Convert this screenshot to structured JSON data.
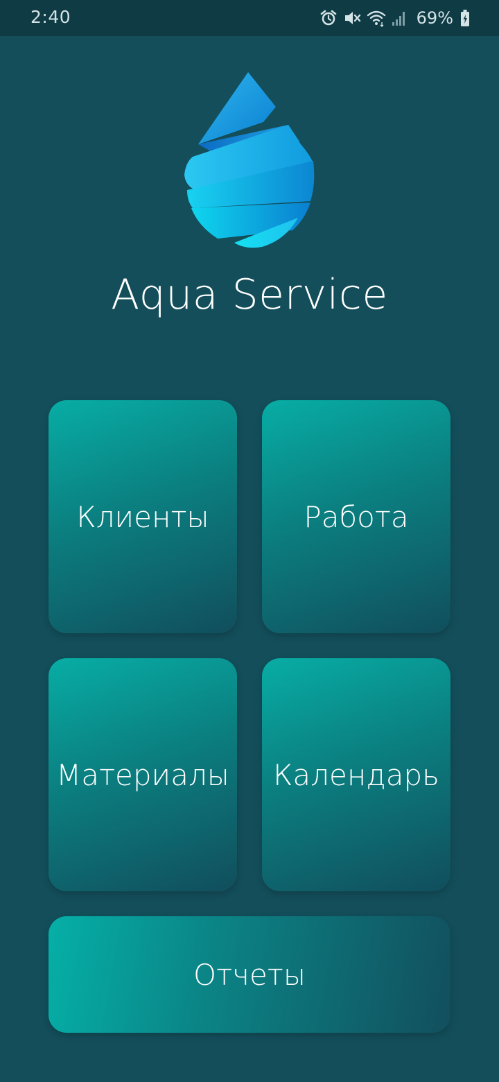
{
  "status_bar": {
    "time": "2:40",
    "battery_percent": "69%",
    "icons": [
      "alarm-icon",
      "mute-icon",
      "wifi-icon",
      "signal-icon",
      "battery-icon"
    ]
  },
  "app": {
    "title": "Aqua Service",
    "logo": "water-drop-logo"
  },
  "menu": {
    "clients": "Клиенты",
    "work": "Работа",
    "materials": "Материалы",
    "calendar": "Календарь",
    "reports": "Отчеты"
  },
  "colors": {
    "background": "#134e5a",
    "status_bar": "#0f3b45",
    "tile_start": "#08ada5",
    "tile_end": "#114e5c",
    "text": "#ffffff"
  }
}
